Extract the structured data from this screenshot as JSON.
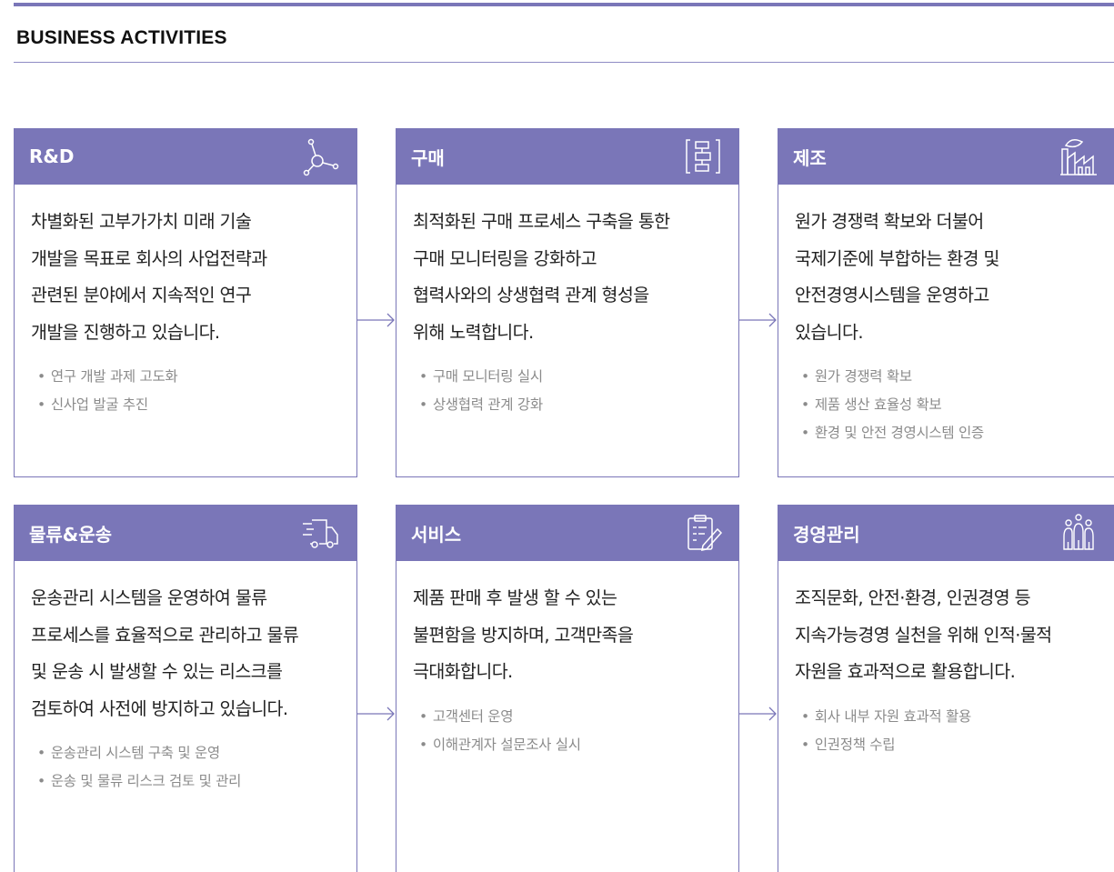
{
  "section": {
    "title": "BUSINESS ACTIVITIES"
  },
  "colors": {
    "accent": "#7a76b8",
    "bullet_text": "#8b8b8b"
  },
  "cards": [
    {
      "title": "R&D",
      "icon": "network-node-icon",
      "desc": [
        "차별화된 고부가가치 미래 기술",
        "개발을 목표로 회사의 사업전략과",
        "관련된 분야에서 지속적인 연구",
        "개발을 진행하고 있습니다."
      ],
      "bullets": [
        "연구 개발 과제 고도화",
        "신사업 발굴 추진"
      ]
    },
    {
      "title": "구매",
      "icon": "flowchart-icon",
      "desc": [
        "최적화된 구매 프로세스 구축을 통한",
        "구매 모니터링을 강화하고",
        "협력사와의 상생협력 관계 형성을",
        "위해 노력합니다."
      ],
      "bullets": [
        "구매 모니터링 실시",
        "상생협력 관계 강화"
      ]
    },
    {
      "title": "제조",
      "icon": "factory-icon",
      "desc": [
        "원가 경쟁력 확보와 더불어",
        "국제기준에 부합하는 환경 및",
        "안전경영시스템을 운영하고",
        "있습니다."
      ],
      "bullets": [
        "원가 경쟁력 확보",
        "제품 생산 효율성 확보",
        "환경 및 안전 경영시스템 인증"
      ]
    },
    {
      "title": "물류&운송",
      "icon": "delivery-truck-icon",
      "desc": [
        "운송관리 시스템을 운영하여 물류",
        "프로세스를 효율적으로 관리하고 물류",
        "및 운송 시 발생할 수 있는 리스크를",
        "검토하여 사전에 방지하고 있습니다."
      ],
      "bullets": [
        "운송관리 시스템 구축 및 운영",
        "운송 및 물류 리스크 검토 및 관리"
      ]
    },
    {
      "title": "서비스",
      "icon": "clipboard-pen-icon",
      "desc": [
        "제품 판매 후 발생 할 수 있는",
        "불편함을 방지하며, 고객만족을",
        "극대화합니다."
      ],
      "bullets": [
        "고객센터 운영",
        "이해관계자 설문조사 실시"
      ]
    },
    {
      "title": "경영관리",
      "icon": "people-group-icon",
      "desc": [
        "조직문화, 안전·환경, 인권경영 등",
        "지속가능경영 실천을 위해 인적·물적",
        "자원을 효과적으로 활용합니다."
      ],
      "bullets": [
        "회사 내부 자원 효과적 활용",
        "인권정책 수립"
      ]
    }
  ]
}
